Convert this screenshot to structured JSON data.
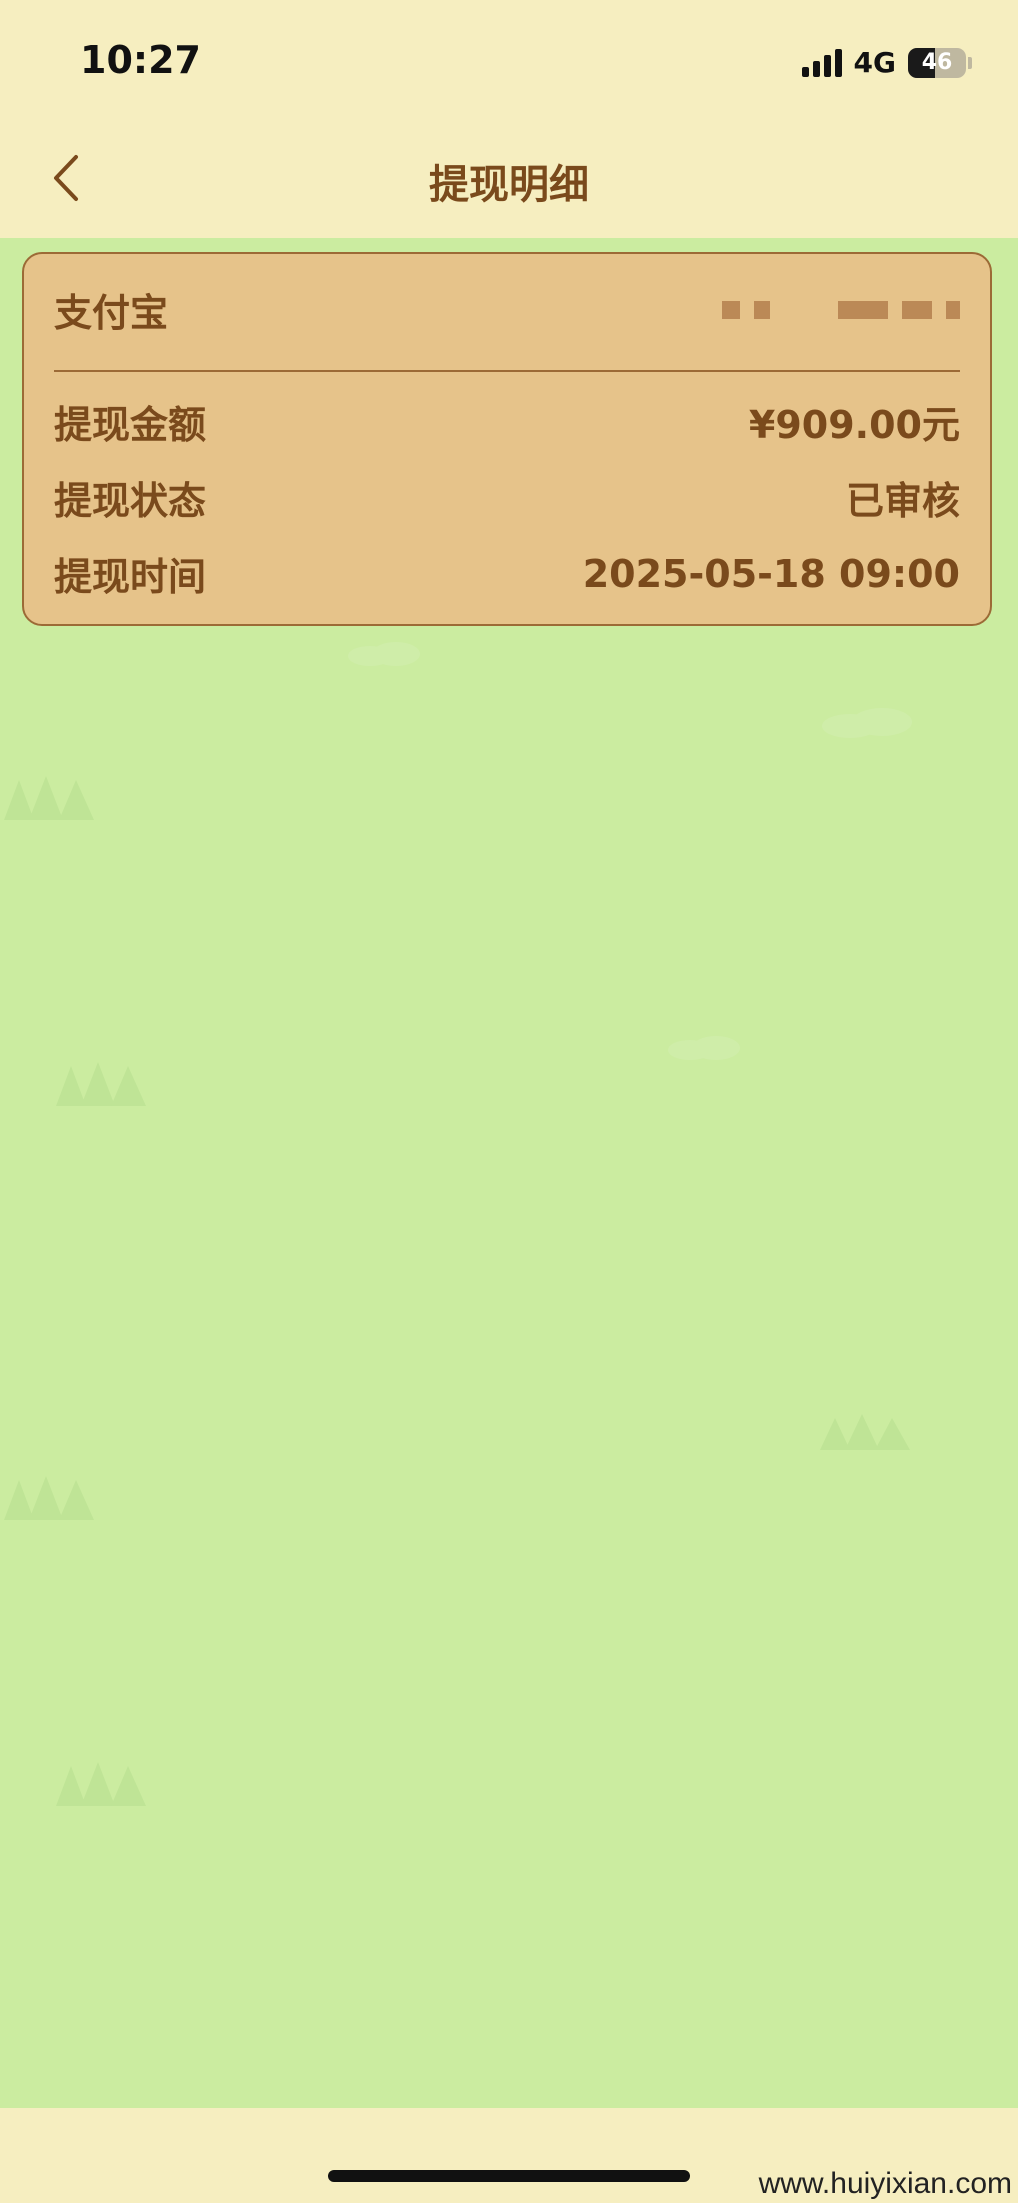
{
  "status_bar": {
    "time": "10:27",
    "network": "4G",
    "battery": "46",
    "battery_level": 0.46
  },
  "nav": {
    "title": "提现明细",
    "back_icon": "chevron-left-icon"
  },
  "card": {
    "account_label": "支付宝",
    "account_value_masked": true,
    "rows": [
      {
        "label": "提现金额",
        "value": "¥909.00元"
      },
      {
        "label": "提现状态",
        "value": "已审核"
      },
      {
        "label": "提现时间",
        "value": "2025-05-18 09:00"
      }
    ]
  },
  "watermark": "www.huiyixian.com",
  "colors": {
    "header_bg": "#f6eec0",
    "content_bg": "#cbeca0",
    "card_bg": "#e6c38a",
    "card_border": "#9c6a36",
    "text_brown": "#7a4a1c"
  }
}
